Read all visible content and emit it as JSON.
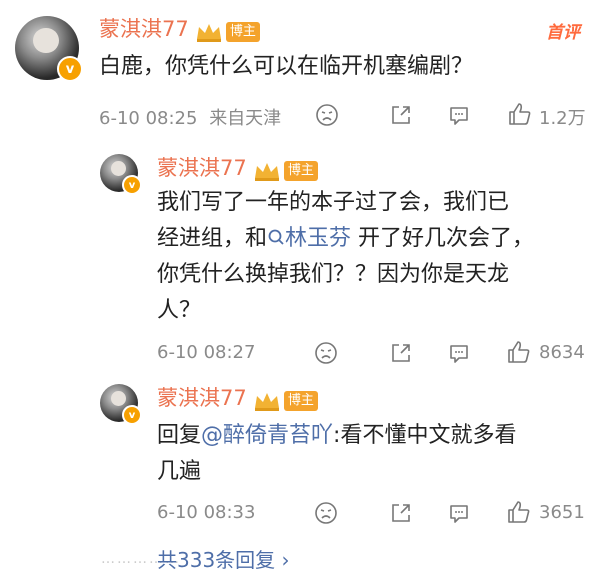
{
  "main_comment": {
    "author": "蒙淇淇77",
    "badge": "博主",
    "text": "白鹿，你凭什么可以在临开机塞编剧？",
    "time": "6-10 08:25",
    "location": "来自天津",
    "likes": "1.2万",
    "hot_tag": "首评"
  },
  "replies": [
    {
      "author": "蒙淇淇77",
      "badge": "博主",
      "lines": [
        "我们写了一年的本子过了会，我们已",
        "经进组，和",
        "林玉芬",
        " 开了好几次会了，",
        "你凭什么换掉我们？？因为你是天龙",
        "人？"
      ],
      "time": "6-10 08:27",
      "likes": "8634"
    },
    {
      "author": "蒙淇淇77",
      "badge": "博主",
      "prefix": "回复",
      "mention": "@醉倚青苔吖",
      "text_rest": ":看不懂中文就多看",
      "text_line2": "几遍",
      "time": "6-10 08:33",
      "likes": "3651"
    }
  ],
  "more_replies": "共333条回复 ›",
  "colors": {
    "name": "#eb7350",
    "link": "#4e6ea8",
    "badge": "#f4a32c",
    "meta": "#8a8a8a"
  }
}
